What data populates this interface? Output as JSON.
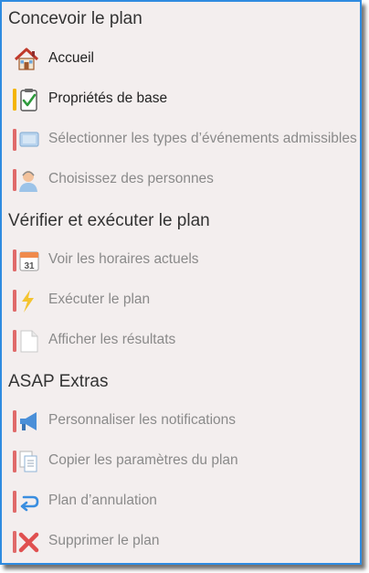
{
  "sections": [
    {
      "title": "Concevoir le plan",
      "items": [
        {
          "label": "Accueil",
          "icon": "home-icon",
          "enabled": true
        },
        {
          "label": "Propriétés de base",
          "icon": "clipboard-check-icon",
          "enabled": true
        },
        {
          "label": "Sélectionner les types d’événements admissibles",
          "icon": "event-types-icon",
          "enabled": false
        },
        {
          "label": "Choisissez des personnes",
          "icon": "person-icon",
          "enabled": false
        }
      ]
    },
    {
      "title": "Vérifier et exécuter le plan",
      "items": [
        {
          "label": "Voir les horaires actuels",
          "icon": "calendar-icon",
          "enabled": false
        },
        {
          "label": "Exécuter le plan",
          "icon": "lightning-icon",
          "enabled": false
        },
        {
          "label": "Afficher les résultats",
          "icon": "document-icon",
          "enabled": false
        }
      ]
    },
    {
      "title": "ASAP Extras",
      "items": [
        {
          "label": "Personnaliser les notifications",
          "icon": "megaphone-icon",
          "enabled": false
        },
        {
          "label": "Copier les paramètres du plan",
          "icon": "copy-icon",
          "enabled": false
        },
        {
          "label": "Plan d’annulation",
          "icon": "undo-icon",
          "enabled": false
        },
        {
          "label": "Supprimer le plan",
          "icon": "delete-x-icon",
          "enabled": false
        }
      ]
    }
  ],
  "colors": {
    "tab_enabled": "#f4b400",
    "tab_disabled": "#e06a6a",
    "border": "#2f8be0",
    "background": "#f3eeee"
  }
}
